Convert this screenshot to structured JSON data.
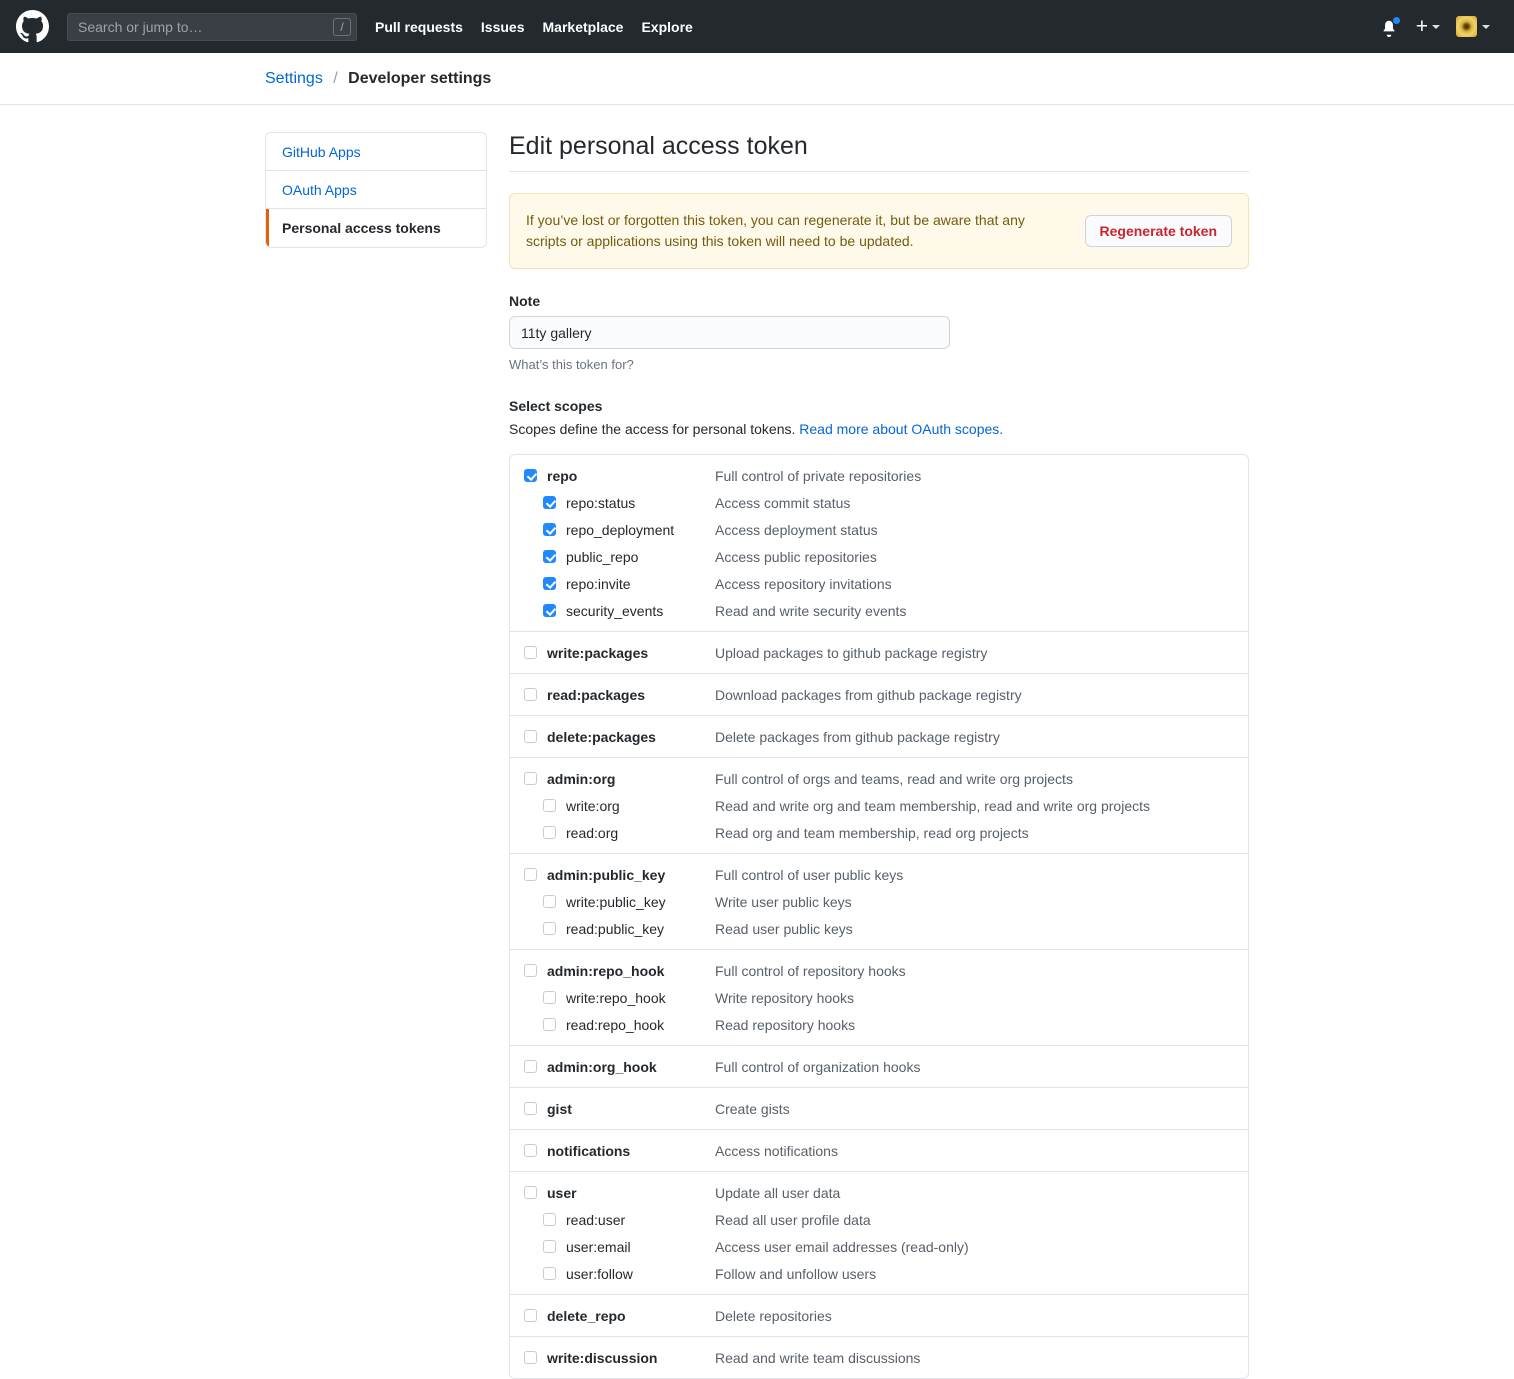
{
  "header": {
    "logo_icon": "github-octocat-icon",
    "search": {
      "placeholder": "Search or jump to…",
      "value": "",
      "shortcut_badge": "/"
    },
    "nav": [
      {
        "label": "Pull requests"
      },
      {
        "label": "Issues"
      },
      {
        "label": "Marketplace"
      },
      {
        "label": "Explore"
      }
    ],
    "notifications_icon": "bell-icon",
    "create_new_icon": "plus-icon",
    "avatar_icon": "user-avatar"
  },
  "breadcrumb": {
    "root": "Settings",
    "separator": "/",
    "current": "Developer settings"
  },
  "sidebar": {
    "items": [
      {
        "label": "GitHub Apps",
        "selected": false
      },
      {
        "label": "OAuth Apps",
        "selected": false
      },
      {
        "label": "Personal access tokens",
        "selected": true
      }
    ]
  },
  "main": {
    "title": "Edit personal access token",
    "flash": {
      "message": "If you’ve lost or forgotten this token, you can regenerate it, but be aware that any scripts or applications using this token will need to be updated.",
      "button_label": "Regenerate token"
    },
    "note": {
      "label": "Note",
      "value": "11ty gallery",
      "placeholder": "What's this token for?",
      "hint": "What’s this token for?"
    },
    "scopes": {
      "title": "Select scopes",
      "description_prefix": "Scopes define the access for personal tokens. ",
      "description_link": "Read more about OAuth scopes.",
      "groups": [
        {
          "rows": [
            {
              "name": "repo",
              "desc": "Full control of private repositories",
              "checked": true,
              "child": false
            },
            {
              "name": "repo:status",
              "desc": "Access commit status",
              "checked": true,
              "child": true
            },
            {
              "name": "repo_deployment",
              "desc": "Access deployment status",
              "checked": true,
              "child": true
            },
            {
              "name": "public_repo",
              "desc": "Access public repositories",
              "checked": true,
              "child": true
            },
            {
              "name": "repo:invite",
              "desc": "Access repository invitations",
              "checked": true,
              "child": true
            },
            {
              "name": "security_events",
              "desc": "Read and write security events",
              "checked": true,
              "child": true
            }
          ]
        },
        {
          "rows": [
            {
              "name": "write:packages",
              "desc": "Upload packages to github package registry",
              "checked": false,
              "child": false
            }
          ]
        },
        {
          "rows": [
            {
              "name": "read:packages",
              "desc": "Download packages from github package registry",
              "checked": false,
              "child": false
            }
          ]
        },
        {
          "rows": [
            {
              "name": "delete:packages",
              "desc": "Delete packages from github package registry",
              "checked": false,
              "child": false
            }
          ]
        },
        {
          "rows": [
            {
              "name": "admin:org",
              "desc": "Full control of orgs and teams, read and write org projects",
              "checked": false,
              "child": false
            },
            {
              "name": "write:org",
              "desc": "Read and write org and team membership, read and write org projects",
              "checked": false,
              "child": true
            },
            {
              "name": "read:org",
              "desc": "Read org and team membership, read org projects",
              "checked": false,
              "child": true
            }
          ]
        },
        {
          "rows": [
            {
              "name": "admin:public_key",
              "desc": "Full control of user public keys",
              "checked": false,
              "child": false
            },
            {
              "name": "write:public_key",
              "desc": "Write user public keys",
              "checked": false,
              "child": true
            },
            {
              "name": "read:public_key",
              "desc": "Read user public keys",
              "checked": false,
              "child": true
            }
          ]
        },
        {
          "rows": [
            {
              "name": "admin:repo_hook",
              "desc": "Full control of repository hooks",
              "checked": false,
              "child": false
            },
            {
              "name": "write:repo_hook",
              "desc": "Write repository hooks",
              "checked": false,
              "child": true
            },
            {
              "name": "read:repo_hook",
              "desc": "Read repository hooks",
              "checked": false,
              "child": true
            }
          ]
        },
        {
          "rows": [
            {
              "name": "admin:org_hook",
              "desc": "Full control of organization hooks",
              "checked": false,
              "child": false
            }
          ]
        },
        {
          "rows": [
            {
              "name": "gist",
              "desc": "Create gists",
              "checked": false,
              "child": false
            }
          ]
        },
        {
          "rows": [
            {
              "name": "notifications",
              "desc": "Access notifications",
              "checked": false,
              "child": false
            }
          ]
        },
        {
          "rows": [
            {
              "name": "user",
              "desc": "Update all user data",
              "checked": false,
              "child": false
            },
            {
              "name": "read:user",
              "desc": "Read all user profile data",
              "checked": false,
              "child": true
            },
            {
              "name": "user:email",
              "desc": "Access user email addresses (read-only)",
              "checked": false,
              "child": true
            },
            {
              "name": "user:follow",
              "desc": "Follow and unfollow users",
              "checked": false,
              "child": true
            }
          ]
        },
        {
          "rows": [
            {
              "name": "delete_repo",
              "desc": "Delete repositories",
              "checked": false,
              "child": false
            }
          ]
        },
        {
          "rows": [
            {
              "name": "write:discussion",
              "desc": "Read and write team discussions",
              "checked": false,
              "child": false
            }
          ]
        }
      ]
    }
  },
  "colors": {
    "header_bg": "#24292e",
    "link_blue": "#0366d6",
    "accent_orange": "#e36209",
    "danger_red": "#cb2431",
    "flash_bg": "#fff9ea",
    "checkbox_blue": "#2188ff"
  }
}
